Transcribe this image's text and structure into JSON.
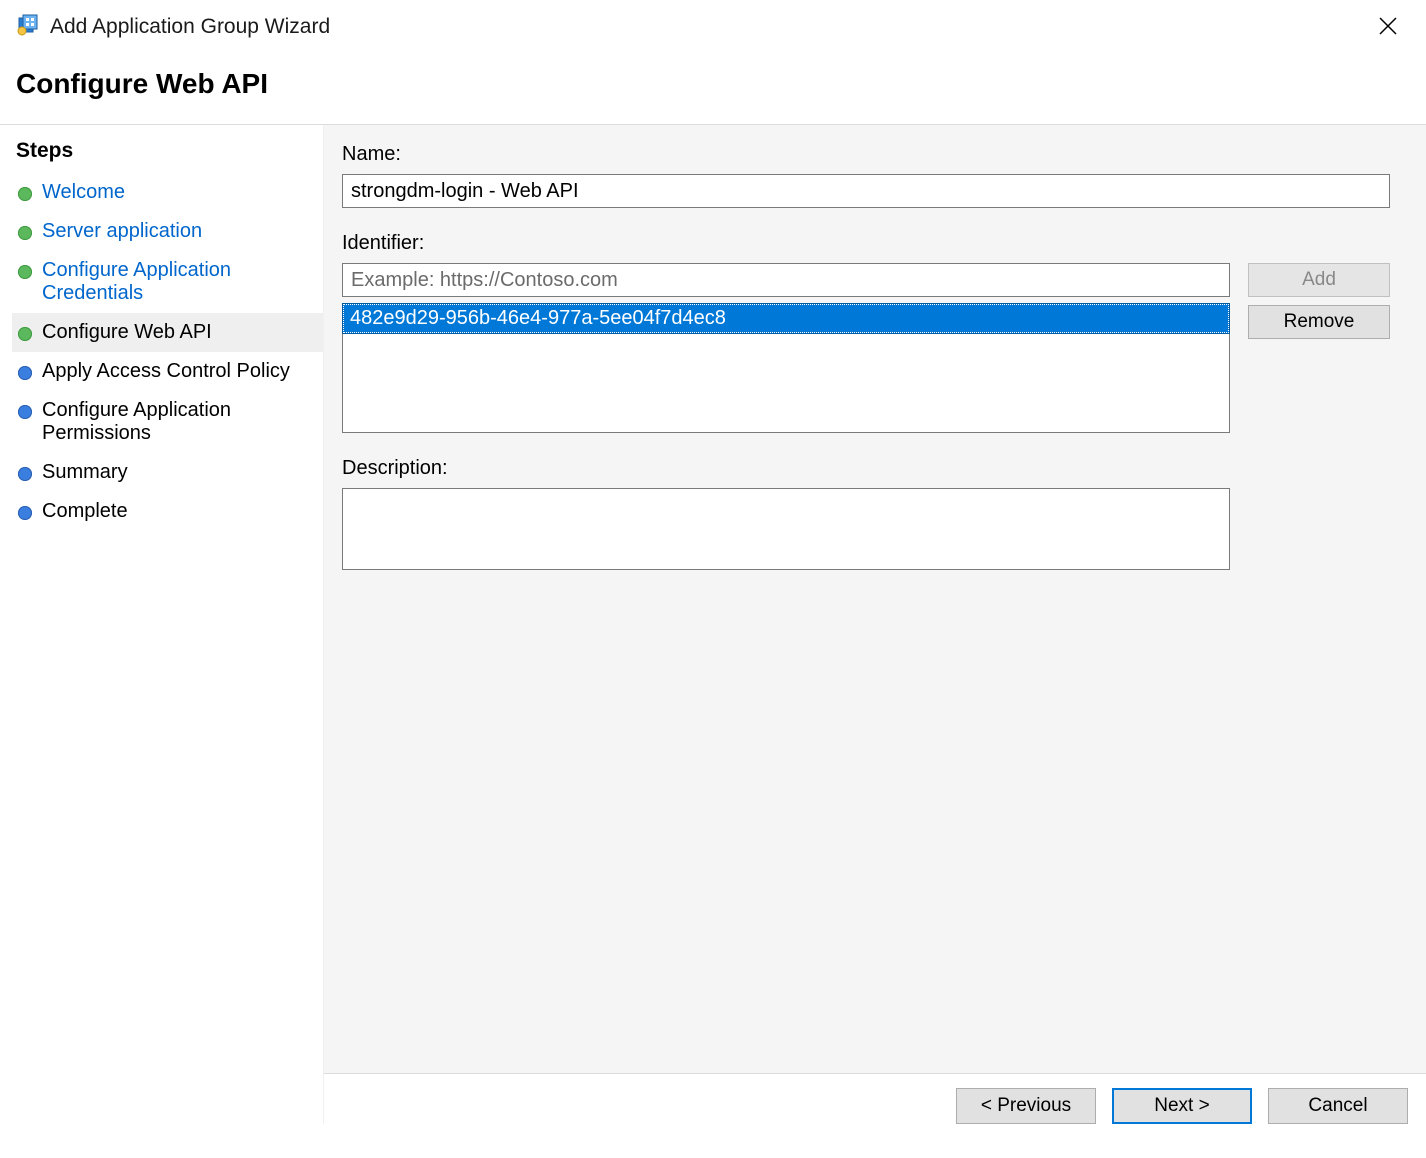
{
  "window": {
    "title": "Add Application Group Wizard",
    "page_title": "Configure Web API"
  },
  "sidebar": {
    "heading": "Steps",
    "items": [
      {
        "label": "Welcome",
        "status": "done",
        "link": true
      },
      {
        "label": "Server application",
        "status": "done",
        "link": true
      },
      {
        "label": "Configure Application Credentials",
        "status": "done",
        "link": true
      },
      {
        "label": "Configure Web API",
        "status": "done",
        "link": false,
        "current": true
      },
      {
        "label": "Apply Access Control Policy",
        "status": "todo",
        "link": false
      },
      {
        "label": "Configure Application Permissions",
        "status": "todo",
        "link": false
      },
      {
        "label": "Summary",
        "status": "todo",
        "link": false
      },
      {
        "label": "Complete",
        "status": "todo",
        "link": false
      }
    ]
  },
  "form": {
    "name_label": "Name:",
    "name_value": "strongdm-login - Web API",
    "identifier_label": "Identifier:",
    "identifier_placeholder": "Example: https://Contoso.com",
    "identifier_value": "",
    "add_button": "Add",
    "remove_button": "Remove",
    "identifiers": [
      "482e9d29-956b-46e4-977a-5ee04f7d4ec8"
    ],
    "description_label": "Description:",
    "description_value": ""
  },
  "footer": {
    "previous": "< Previous",
    "next": "Next >",
    "cancel": "Cancel"
  }
}
